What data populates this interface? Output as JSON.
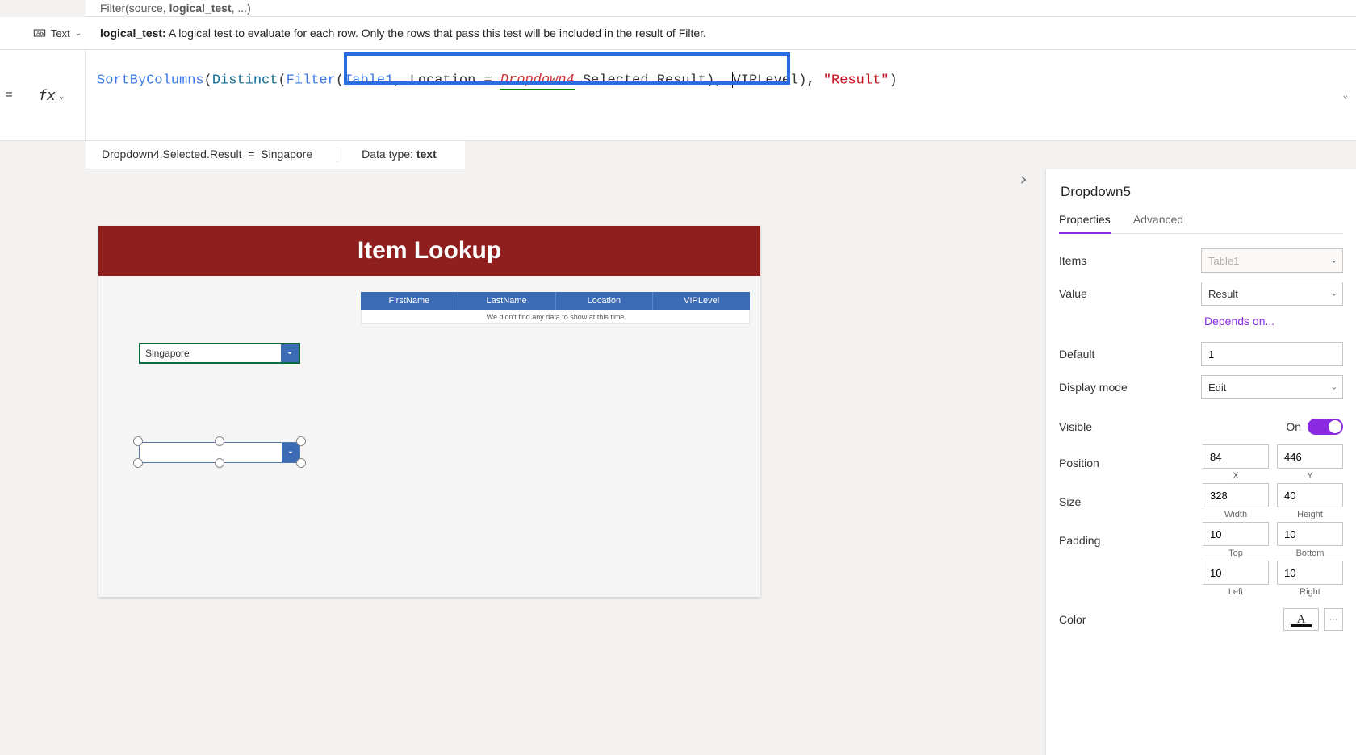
{
  "signature": {
    "fn": "Filter",
    "args_pre": "(source, ",
    "args_bold": "logical_test",
    "args_post": ", ...)"
  },
  "help": {
    "param": "logical_test:",
    "text": "A logical test to evaluate for each row. Only the rows that pass this test will be included in the result of Filter."
  },
  "text_dropdown": "Text",
  "formula": {
    "p1": "SortByColumns",
    "p2": "(",
    "p3": "Distinct",
    "p4": "(",
    "p5": "Filter",
    "p6": "(",
    "p7": "Table1",
    "p8": ", Location = ",
    "p9": "Dropdown4",
    "p10": ".Selected.Result",
    "p11": ")",
    "p12": ", ",
    "p13": "VIPLevel), ",
    "p14": "\"Result\"",
    "p15": ")"
  },
  "eval": {
    "lhs": "Dropdown4.Selected.Result",
    "eq": "=",
    "rhs": "Singapore",
    "dt_label": "Data type: ",
    "dt_value": "text"
  },
  "canvas": {
    "title": "Item Lookup",
    "cols": [
      "FirstName",
      "LastName",
      "Location",
      "VIPLevel"
    ],
    "empty_msg": "We didn't find any data to show at this time",
    "dropdown4_value": "Singapore",
    "dropdown5_value": ""
  },
  "panel": {
    "control_name": "Dropdown5",
    "tabs": {
      "properties": "Properties",
      "advanced": "Advanced"
    },
    "items_label": "Items",
    "items_value": "Table1",
    "value_label": "Value",
    "value_value": "Result",
    "depends": "Depends on...",
    "default_label": "Default",
    "default_value": "1",
    "display_label": "Display mode",
    "display_value": "Edit",
    "visible_label": "Visible",
    "visible_on": "On",
    "position_label": "Position",
    "pos_x": "84",
    "pos_y": "446",
    "sub_x": "X",
    "sub_y": "Y",
    "size_label": "Size",
    "size_w": "328",
    "size_h": "40",
    "sub_w": "Width",
    "sub_h": "Height",
    "padding_label": "Padding",
    "pad_t": "10",
    "pad_b": "10",
    "pad_l": "10",
    "pad_r": "10",
    "sub_t": "Top",
    "sub_btm": "Bottom",
    "sub_l": "Left",
    "sub_r": "Right",
    "color_label": "Color",
    "color_glyph": "A"
  }
}
